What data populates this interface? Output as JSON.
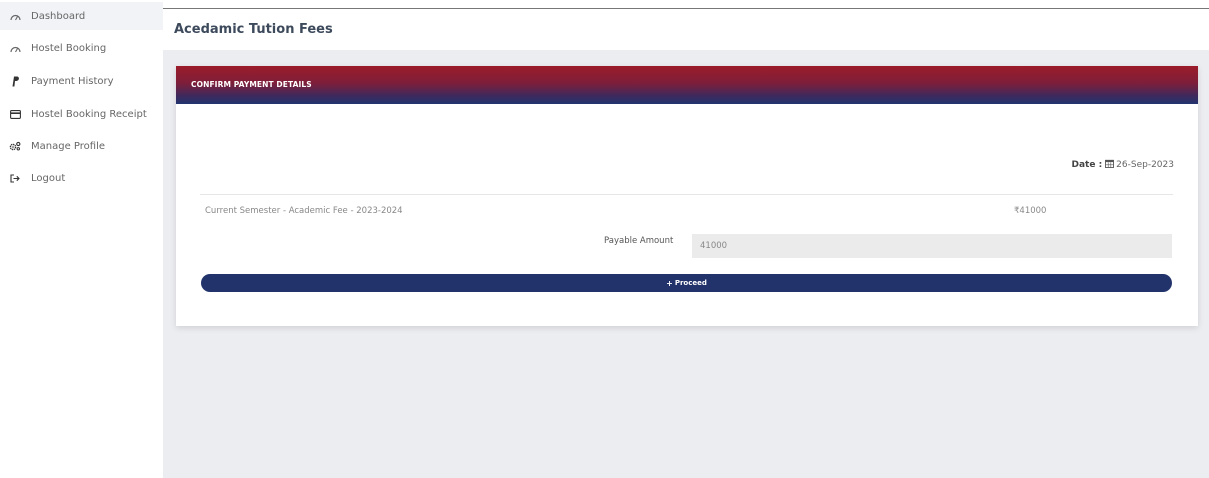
{
  "sidebar": {
    "items": [
      {
        "label": "Dashboard",
        "icon": "dashboard-icon"
      },
      {
        "label": "Hostel Booking",
        "icon": "dashboard-icon"
      },
      {
        "label": "Payment History",
        "icon": "paypal-icon"
      },
      {
        "label": "Hostel Booking Receipt",
        "icon": "credit-card-icon"
      },
      {
        "label": "Manage Profile",
        "icon": "cogs-icon"
      },
      {
        "label": "Logout",
        "icon": "logout-icon"
      }
    ]
  },
  "header": {
    "title": "Acedamic Tution Fees"
  },
  "card": {
    "title": "CONFIRM PAYMENT DETAILS",
    "date_label": "Date :",
    "date_value": "26-Sep-2023",
    "fee_description": "Current Semester - Academic Fee - 2023-2024",
    "fee_amount": "₹41000",
    "payable_label": "Payable Amount",
    "payable_value": "41000",
    "proceed_label": "Proceed"
  },
  "colors": {
    "accent_navy": "#22336b",
    "header_red": "#9b1c2a"
  }
}
